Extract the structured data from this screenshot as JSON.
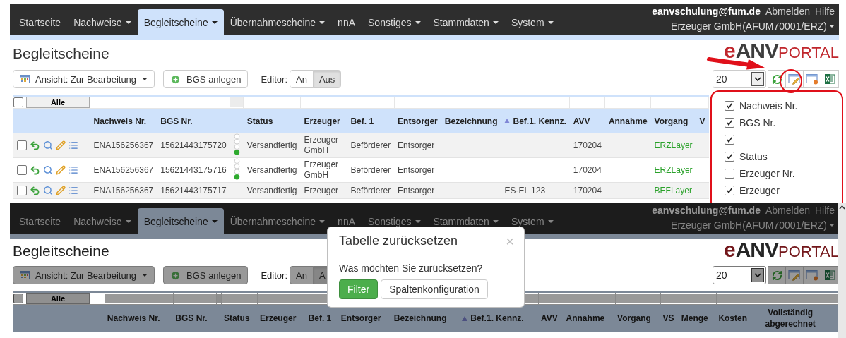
{
  "panels": [
    {
      "annotated": true,
      "nav": {
        "items": [
          {
            "label": "Startseite",
            "has_menu": false,
            "selected": false
          },
          {
            "label": "Nachweise",
            "has_menu": true,
            "selected": false
          },
          {
            "label": "Begleitscheine",
            "has_menu": true,
            "selected": true
          },
          {
            "label": "Übernahmescheine",
            "has_menu": true,
            "selected": false
          },
          {
            "label": "nnA",
            "has_menu": false,
            "selected": false
          },
          {
            "label": "Sonstiges",
            "has_menu": true,
            "selected": false
          },
          {
            "label": "Stammdaten",
            "has_menu": true,
            "selected": false
          },
          {
            "label": "System",
            "has_menu": true,
            "selected": false
          }
        ],
        "user": "eanvschulung@fum.de",
        "links": [
          "Abmelden",
          "Hilfe"
        ],
        "organization": "Erzeuger GmbH(AFUM70001/ERZ)"
      },
      "page_title": "Begleitscheine",
      "logo": {
        "prefix": "e",
        "brand": "ANV",
        "suffix": "PORTAL"
      },
      "toolbar": {
        "view": "Ansicht: Zur Bearbeitung",
        "create_button": "BGS anlegen",
        "editor_label": "Editor:",
        "editor_options": [
          {
            "label": "An",
            "selected": false
          },
          {
            "label": "Aus",
            "selected": true
          }
        ],
        "page_size": "20"
      },
      "table": {
        "all_button": "Alle",
        "all_checked": false,
        "columns": [
          {
            "label": "Nachweis Nr.",
            "kind": "text"
          },
          {
            "label": "BGS Nr.",
            "kind": "text"
          },
          {
            "kind": "dots"
          },
          {
            "label": "Status",
            "kind": "text"
          },
          {
            "label": "Erzeuger",
            "kind": "text"
          },
          {
            "label": "Bef. 1",
            "kind": "text"
          },
          {
            "label": "Entsorger",
            "kind": "text"
          },
          {
            "label": "Bezeichnung",
            "kind": "text"
          },
          {
            "label": "Bef.1. Kennz.",
            "kind": "text",
            "sorted": true
          },
          {
            "label": "AVV",
            "kind": "text"
          },
          {
            "label": "Annahme",
            "kind": "text"
          },
          {
            "label": "Vorgang",
            "kind": "link"
          },
          {
            "label": "V",
            "kind": "text"
          }
        ],
        "rows": [
          {
            "checked": false,
            "cells": [
              {
                "text": "ENA156256367"
              },
              {
                "text": "15621443175720"
              },
              {},
              {
                "text": "Versandfertig"
              },
              {
                "text": "Erzeuger GmbH"
              },
              {
                "text": "Beförderer"
              },
              {
                "text": "Entsorger"
              },
              {},
              {},
              {
                "text": "170204"
              },
              {},
              {
                "text": "ERZLayer"
              },
              {}
            ]
          },
          {
            "checked": false,
            "cells": [
              {
                "text": "ENA156256367"
              },
              {
                "text": "15621443175716"
              },
              {},
              {
                "text": "Versandfertig"
              },
              {
                "text": "Erzeuger GmbH"
              },
              {
                "text": "Beförderer"
              },
              {
                "text": "Entsorger"
              },
              {},
              {},
              {
                "text": "170204"
              },
              {},
              {
                "text": "ERZLayer"
              },
              {}
            ]
          },
          {
            "checked": false,
            "cells": [
              {
                "text": "ENA156256367"
              },
              {
                "text": "15621443175717"
              },
              {},
              {
                "text": "Versandfertig"
              },
              {
                "text": "Erzeuger"
              },
              {
                "text": "Beförderer"
              },
              {
                "text": "Entsorger"
              },
              {},
              {
                "text": "ES-EL 123"
              },
              {
                "text": "170204"
              },
              {},
              {
                "text": "BEFLayer"
              },
              {}
            ]
          }
        ]
      },
      "column_menu": {
        "items": [
          {
            "label": "Nachweis Nr.",
            "checked": true
          },
          {
            "label": "BGS Nr.",
            "checked": true
          },
          {
            "checked": true
          },
          {
            "label": "Status",
            "checked": true
          },
          {
            "label": "Erzeuger Nr.",
            "checked": false
          },
          {
            "label": "Erzeuger",
            "checked": true
          }
        ]
      }
    },
    {
      "dimmed": true,
      "nav": {
        "items": [
          {
            "label": "Startseite",
            "has_menu": false,
            "selected": false
          },
          {
            "label": "Nachweise",
            "has_menu": true,
            "selected": false
          },
          {
            "label": "Begleitscheine",
            "has_menu": true,
            "selected": true
          },
          {
            "label": "Übernahmescheine",
            "has_menu": true,
            "selected": false
          },
          {
            "label": "nnA",
            "has_menu": false,
            "selected": false
          },
          {
            "label": "Sonstiges",
            "has_menu": true,
            "selected": false
          },
          {
            "label": "Stammdaten",
            "has_menu": true,
            "selected": false
          },
          {
            "label": "System",
            "has_menu": true,
            "selected": false
          }
        ],
        "user": "eanvschulung@fum.de",
        "links": [
          "Abmelden",
          "Hilfe"
        ],
        "organization": "Erzeuger GmbH(AFUM70001/ERZ)"
      },
      "page_title": "Begleitscheine",
      "logo": {
        "prefix": "e",
        "brand": "ANV",
        "suffix": "PORTAL"
      },
      "toolbar": {
        "view": "Ansicht: Zur Bearbeitung",
        "create_button": "BGS anlegen",
        "editor_label": "Editor:",
        "editor_options": [
          {
            "label": "An",
            "selected": false
          },
          {
            "label": "A",
            "selected": true
          }
        ],
        "page_size": "20"
      },
      "table": {
        "all_button": "Alle",
        "all_checked": false,
        "columns": [
          {
            "label": "Nachweis Nr.",
            "kind": "text"
          },
          {
            "label": "BGS Nr.",
            "kind": "text"
          },
          {
            "kind": "dots"
          },
          {
            "label": "Status",
            "kind": "text"
          },
          {
            "label": "Erzeuger",
            "kind": "text"
          },
          {
            "label": "Bef. 1",
            "kind": "text"
          },
          {
            "label": "Entsorger",
            "kind": "text"
          },
          {
            "label": "Bezeichnung",
            "kind": "text"
          },
          {
            "label": "Bef.1. Kennz.",
            "kind": "text",
            "sorted": true
          },
          {
            "label": "AVV",
            "kind": "text"
          },
          {
            "label": "Annahme",
            "kind": "text"
          },
          {
            "label": "Vorgang",
            "kind": "link"
          },
          {
            "label": "VS",
            "kind": "text"
          },
          {
            "label": "Menge",
            "kind": "text"
          },
          {
            "label": "Kosten",
            "kind": "text"
          },
          {
            "label": "Vollständig abgerechnet",
            "kind": "text"
          }
        ]
      },
      "dialog": {
        "title": "Tabelle zurücksetzen",
        "close": "×",
        "message": "Was möchten Sie zurücksetzen?",
        "buttons": [
          {
            "label": "Filter",
            "primary": true
          },
          {
            "label": "Spaltenkonfiguration",
            "primary": false
          }
        ]
      }
    }
  ]
}
